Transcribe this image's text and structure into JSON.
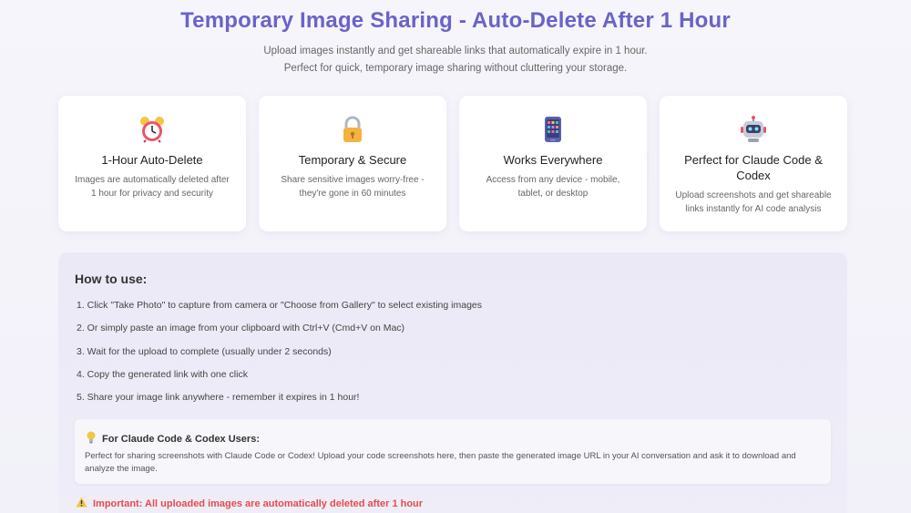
{
  "header": {
    "title": "Temporary Image Sharing - Auto-Delete After 1 Hour",
    "subtitle_line1": "Upload images instantly and get shareable links that automatically expire in 1 hour.",
    "subtitle_line2": "Perfect for quick, temporary image sharing without cluttering your storage."
  },
  "features": [
    {
      "icon": "alarm-clock-icon",
      "title": "1-Hour Auto-Delete",
      "desc1": "Images are automatically deleted after",
      "desc2": "1 hour for privacy and security"
    },
    {
      "icon": "lock-icon",
      "title": "Temporary & Secure",
      "desc1": "Share sensitive images worry-free -",
      "desc2": "they're gone in 60 minutes"
    },
    {
      "icon": "mobile-phone-icon",
      "title": "Works Everywhere",
      "desc1": "Access from any device - mobile,",
      "desc2": "tablet, or desktop"
    },
    {
      "icon": "robot-icon",
      "title": "Perfect for Claude Code & Codex",
      "desc1": "Upload screenshots and get shareable",
      "desc2": "links instantly for AI code analysis"
    }
  ],
  "howto": {
    "heading": "How to use:",
    "steps": [
      "1. Click \"Take Photo\" to capture from camera or \"Choose from Gallery\" to select existing images",
      "2. Or simply paste an image from your clipboard with Ctrl+V (Cmd+V on Mac)",
      "3. Wait for the upload to complete (usually under 2 seconds)",
      "4. Copy the generated link with one click",
      "5. Share your image link anywhere - remember it expires in 1 hour!"
    ],
    "tip": {
      "icon": "lightbulb-icon",
      "title": "For Claude Code & Codex Users:",
      "body": "Perfect for sharing screenshots with Claude Code or Codex! Upload your code screenshots here, then paste the generated image URL in your AI conversation and ask it to download and analyze the image."
    },
    "important": {
      "icon": "warning-icon",
      "text": "Important: All uploaded images are automatically deleted after 1 hour"
    }
  },
  "colors": {
    "title": "#6a63c9",
    "important": "#e74c4c"
  }
}
